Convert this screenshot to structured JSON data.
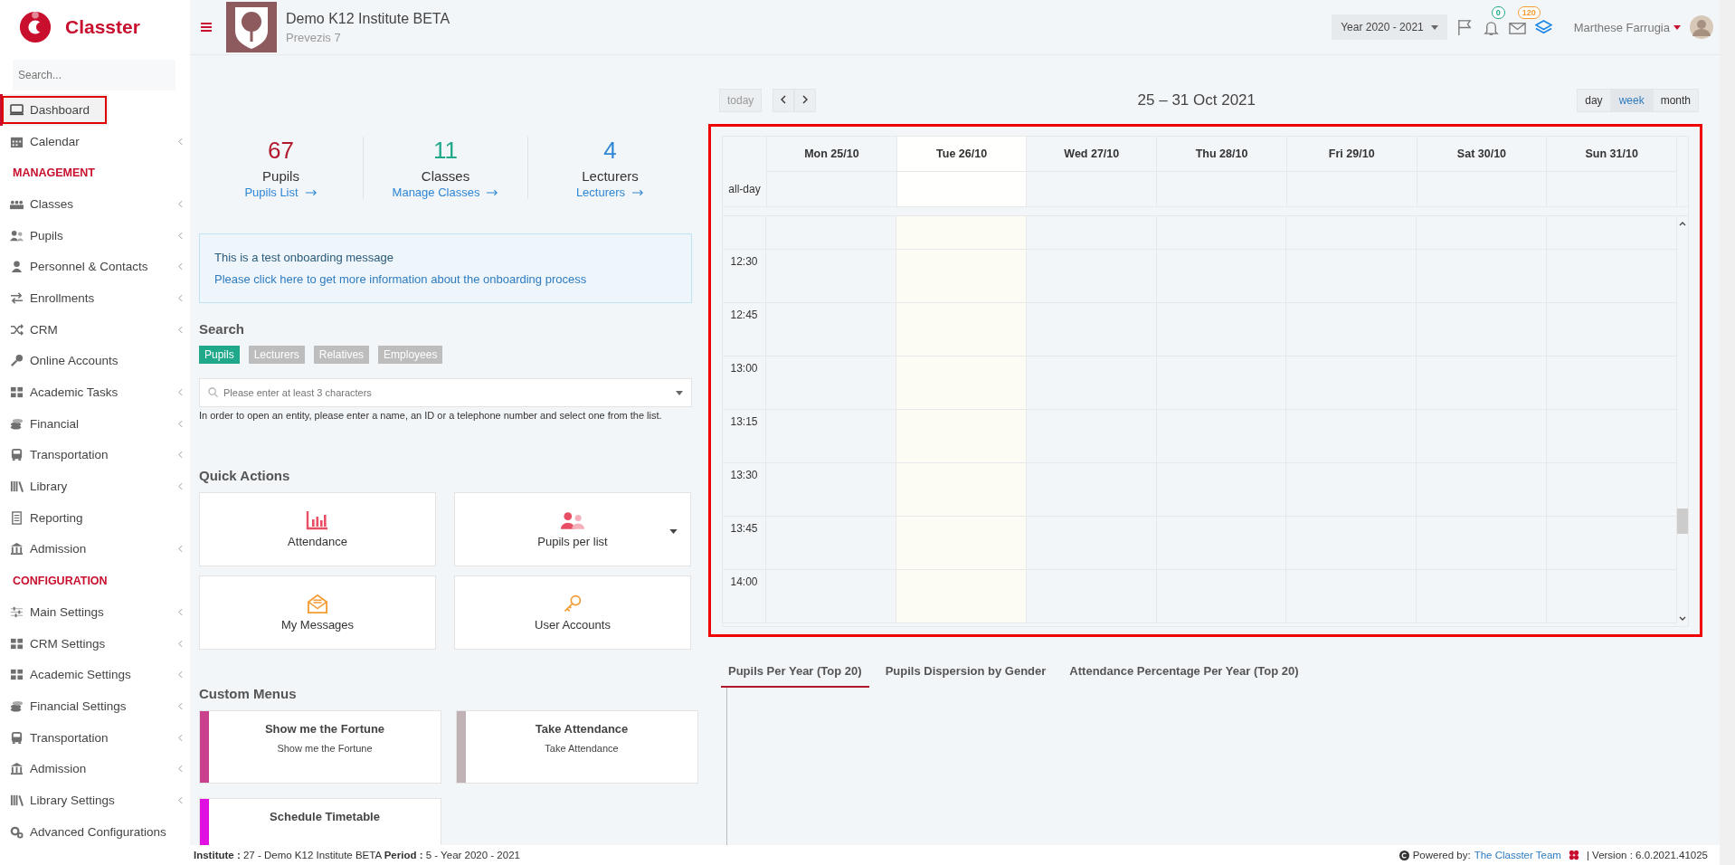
{
  "sidebar": {
    "brand": "Classter",
    "search": {
      "placeholder": "Search..."
    },
    "items": [
      {
        "kind": "item",
        "label": "Dashboard",
        "has_submenu": false,
        "selected": true
      },
      {
        "kind": "item",
        "label": "Calendar",
        "has_submenu": true,
        "selected": false
      },
      {
        "kind": "header",
        "label": "MANAGEMENT"
      },
      {
        "kind": "item",
        "label": "Classes",
        "has_submenu": true,
        "selected": false
      },
      {
        "kind": "item",
        "label": "Pupils",
        "has_submenu": true,
        "selected": false
      },
      {
        "kind": "item",
        "label": "Personnel & Contacts",
        "has_submenu": true,
        "selected": false
      },
      {
        "kind": "item",
        "label": "Enrollments",
        "has_submenu": true,
        "selected": false
      },
      {
        "kind": "item",
        "label": "CRM",
        "has_submenu": true,
        "selected": false
      },
      {
        "kind": "item",
        "label": "Online Accounts",
        "has_submenu": false,
        "selected": false
      },
      {
        "kind": "item",
        "label": "Academic Tasks",
        "has_submenu": true,
        "selected": false
      },
      {
        "kind": "item",
        "label": "Financial",
        "has_submenu": true,
        "selected": false
      },
      {
        "kind": "item",
        "label": "Transportation",
        "has_submenu": true,
        "selected": false
      },
      {
        "kind": "item",
        "label": "Library",
        "has_submenu": true,
        "selected": false
      },
      {
        "kind": "item",
        "label": "Reporting",
        "has_submenu": false,
        "selected": false
      },
      {
        "kind": "item",
        "label": "Admission",
        "has_submenu": true,
        "selected": false
      },
      {
        "kind": "header",
        "label": "CONFIGURATION"
      },
      {
        "kind": "item",
        "label": "Main Settings",
        "has_submenu": true,
        "selected": false
      },
      {
        "kind": "item",
        "label": "CRM Settings",
        "has_submenu": true,
        "selected": false
      },
      {
        "kind": "item",
        "label": "Academic Settings",
        "has_submenu": true,
        "selected": false
      },
      {
        "kind": "item",
        "label": "Financial Settings",
        "has_submenu": true,
        "selected": false
      },
      {
        "kind": "item",
        "label": "Transportation",
        "has_submenu": true,
        "selected": false
      },
      {
        "kind": "item",
        "label": "Admission",
        "has_submenu": true,
        "selected": false
      },
      {
        "kind": "item",
        "label": "Library Settings",
        "has_submenu": true,
        "selected": false
      },
      {
        "kind": "item",
        "label": "Advanced Configurations",
        "has_submenu": false,
        "selected": false
      }
    ]
  },
  "topbar": {
    "institute": "Demo K12 Institute BETA",
    "address": "Prevezis 7",
    "year_select": "Year 2020 - 2021",
    "notifications_badge": "0",
    "messages_badge": "120",
    "user_name": "Marthese Farrugia"
  },
  "stats": [
    {
      "value": "67",
      "label": "Pupils",
      "link": "Pupils List",
      "color": "#b2182b"
    },
    {
      "value": "11",
      "label": "Classes",
      "link": "Manage Classes",
      "color": "#1fa88a"
    },
    {
      "value": "4",
      "label": "Lecturers",
      "link": "Lecturers",
      "color": "#2e86d6"
    }
  ],
  "onboarding": {
    "message": "This is a test onboarding message",
    "link": "Please click here to get more information about the onboarding process"
  },
  "search": {
    "title": "Search",
    "tabs": [
      {
        "label": "Pupils",
        "selected": true
      },
      {
        "label": "Lecturers",
        "selected": false
      },
      {
        "label": "Relatives",
        "selected": false
      },
      {
        "label": "Employees",
        "selected": false
      }
    ],
    "placeholder": "Please enter at least 3 characters",
    "help": "In order to open an entity, please enter a name, an ID or a telephone number and select one from the list."
  },
  "quick_actions": {
    "title": "Quick Actions",
    "items": [
      {
        "label": "Attendance",
        "has_dropdown": false
      },
      {
        "label": "Pupils per list",
        "has_dropdown": true
      },
      {
        "label": "My Messages",
        "has_dropdown": false
      },
      {
        "label": "User Accounts",
        "has_dropdown": false
      }
    ]
  },
  "custom_menus": {
    "title": "Custom Menus",
    "items": [
      {
        "title": "Show me the Fortune",
        "subtitle": "Show me the Fortune",
        "color": "#c9418d"
      },
      {
        "title": "Take Attendance",
        "subtitle": "Take Attendance",
        "color": "#bfb1b4"
      },
      {
        "title": "Schedule Timetable",
        "color": "#e010e0"
      }
    ]
  },
  "calendar": {
    "highlighted": true,
    "today_button": "today",
    "title": "25 – 31 Oct 2021",
    "views": [
      {
        "label": "day",
        "selected": false
      },
      {
        "label": "week",
        "selected": true
      },
      {
        "label": "month",
        "selected": false
      }
    ],
    "days": [
      {
        "label": "Mon 25/10",
        "today": false
      },
      {
        "label": "Tue 26/10",
        "today": true
      },
      {
        "label": "Wed 27/10",
        "today": false
      },
      {
        "label": "Thu 28/10",
        "today": false
      },
      {
        "label": "Fri 29/10",
        "today": false
      },
      {
        "label": "Sat 30/10",
        "today": false
      },
      {
        "label": "Sun 31/10",
        "today": false
      }
    ],
    "all_day_label": "all-day",
    "times": [
      "12:30",
      "12:45",
      "13:00",
      "13:15",
      "13:30",
      "13:45",
      "14:00"
    ]
  },
  "chart_tabs": [
    {
      "label": "Pupils Per Year (Top 20)",
      "selected": true
    },
    {
      "label": "Pupils Dispersion by Gender",
      "selected": false
    },
    {
      "label": "Attendance Percentage Per Year (Top 20)",
      "selected": false
    }
  ],
  "footer": {
    "info": "**Institute :** 27 - Demo K12 Institute BETA **Period :** 5 - Year 2020 - 2021",
    "powered_by": "Powered by:",
    "team_link": "The Classter Team",
    "version": "| Version : 6.0.2021.41025"
  }
}
